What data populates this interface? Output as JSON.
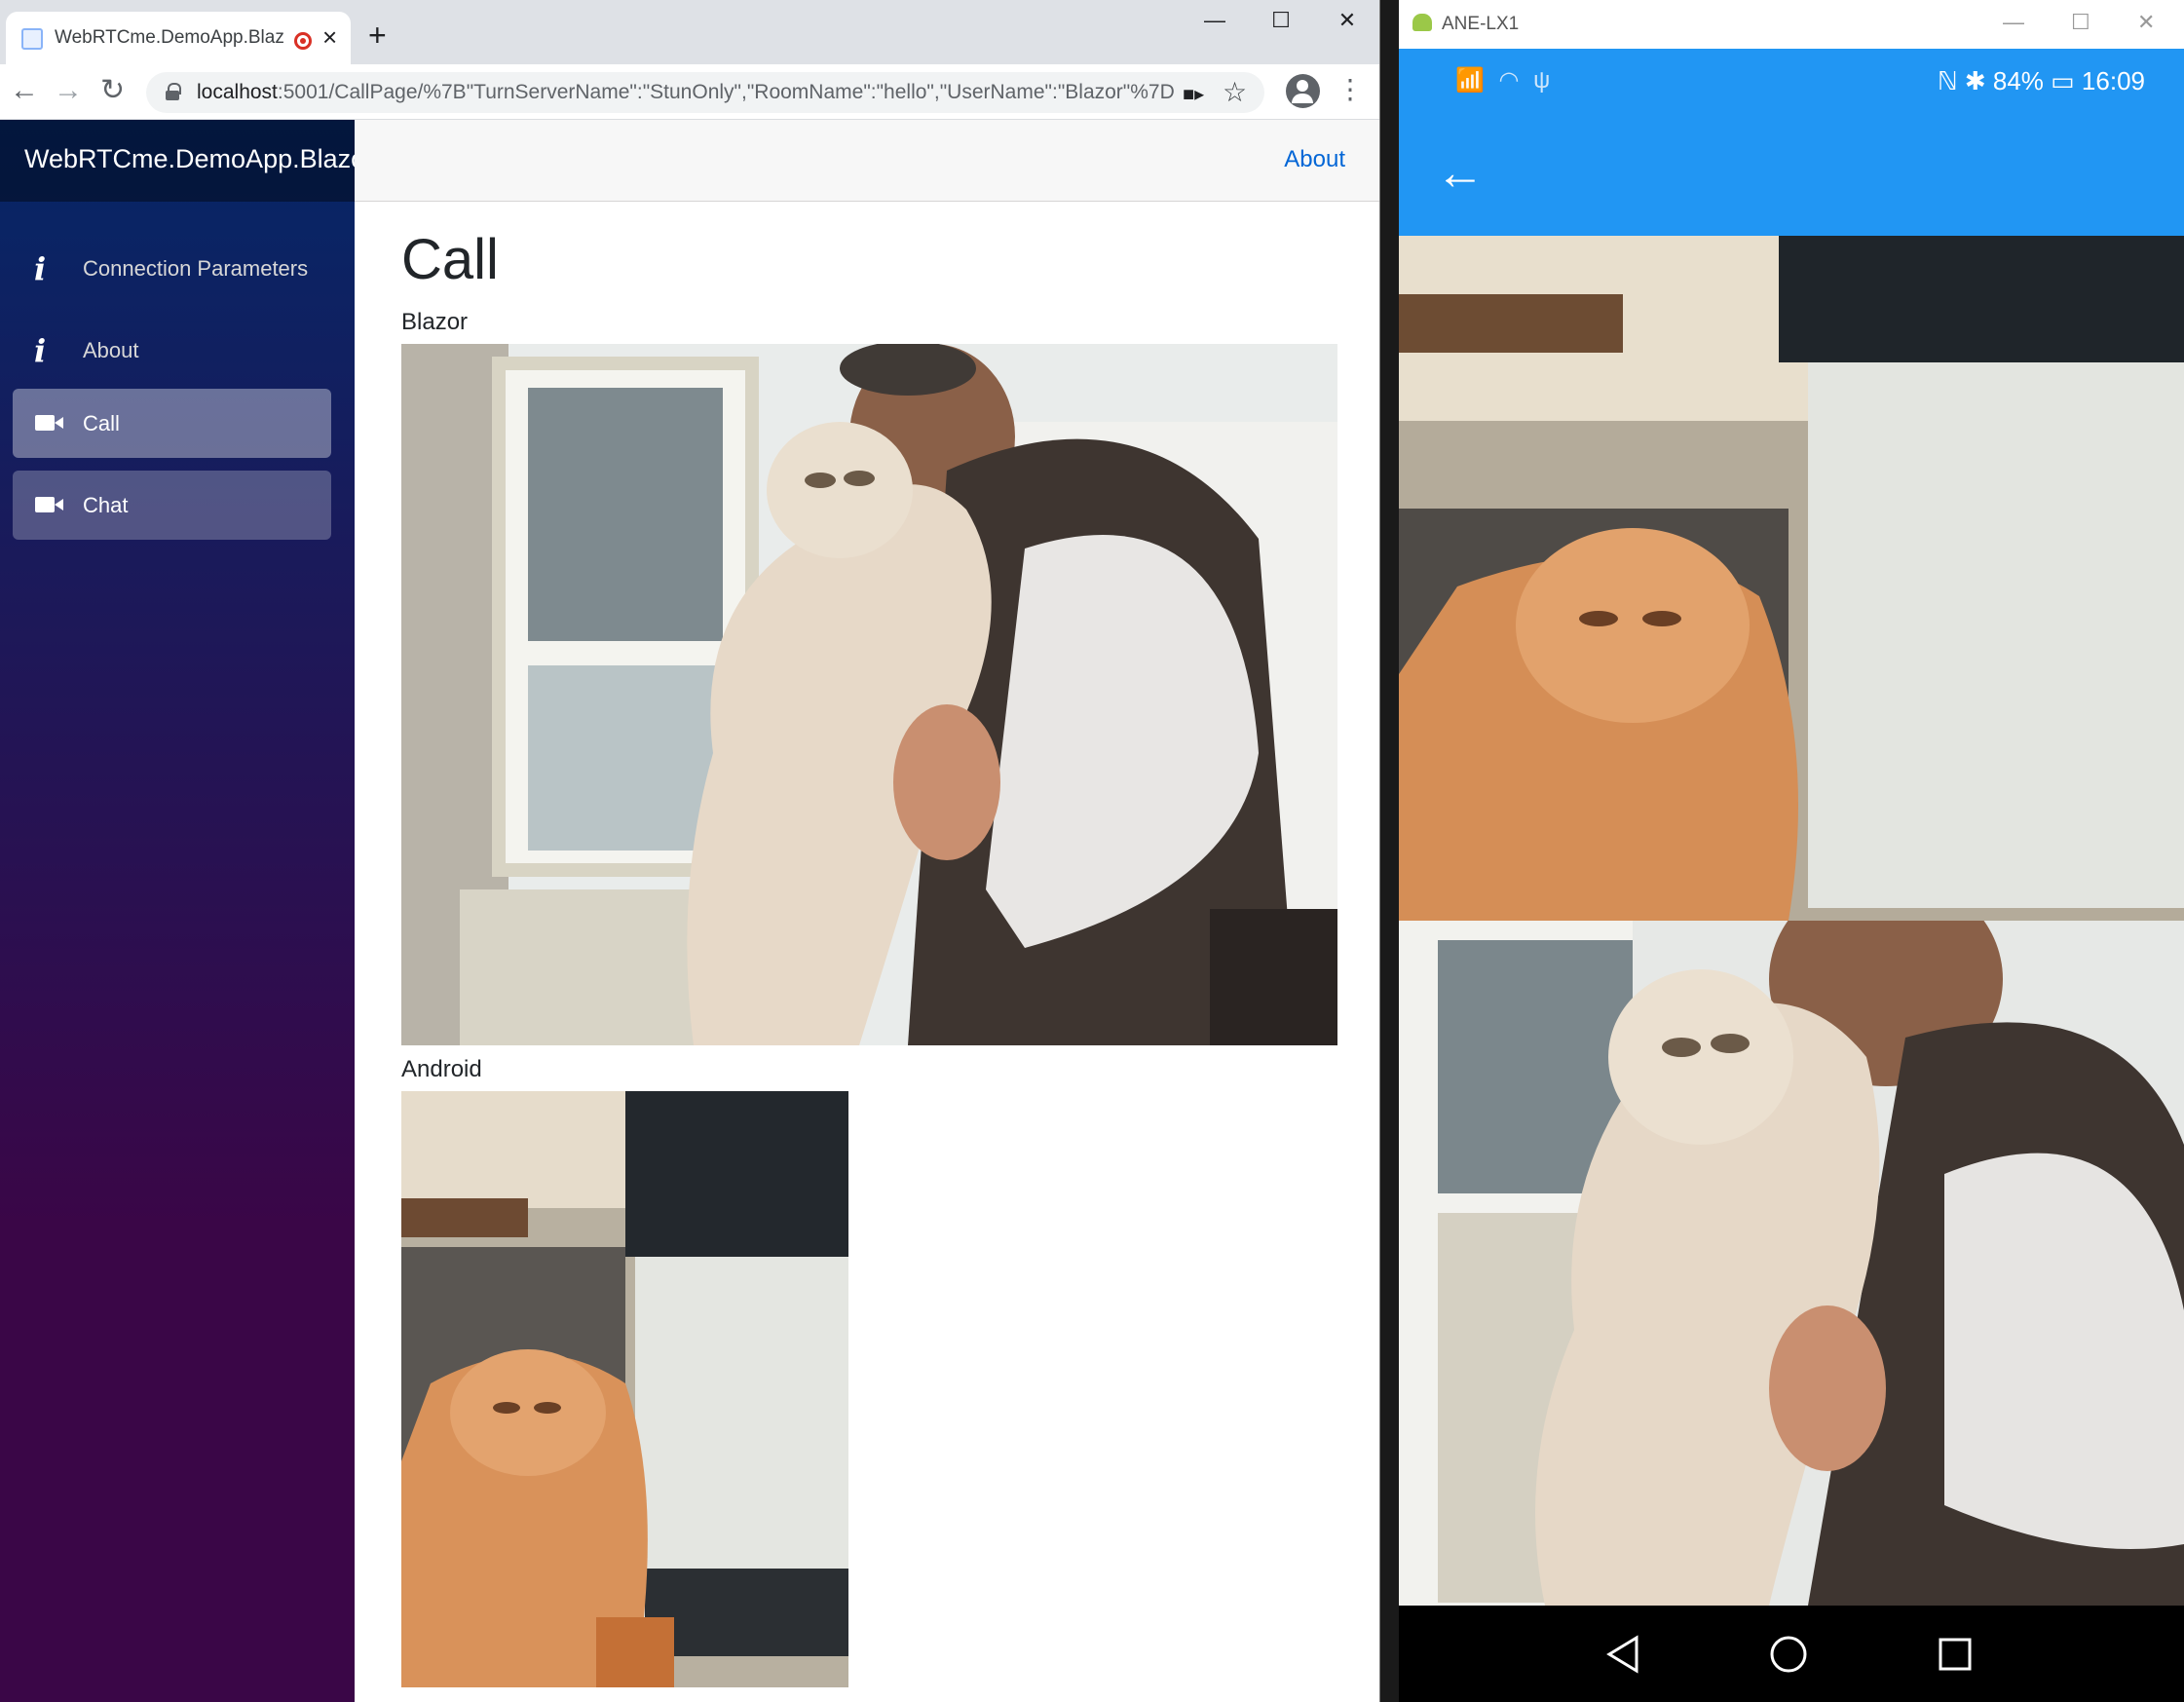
{
  "browser": {
    "tab_title": "WebRTCme.DemoApp.Blazor",
    "tab_close": "×",
    "new_tab": "+",
    "window_controls": {
      "minimize": "—",
      "maximize": "☐",
      "close": "✕"
    },
    "nav": {
      "back": "←",
      "forward": "→",
      "reload": "↻"
    },
    "url_host": "localhost",
    "url_rest": ":5001/CallPage/%7B\"TurnServerName\":\"StunOnly\",\"RoomName\":\"hello\",\"UserName\":\"Blazor\"%7D",
    "camera_indicator": "■▸",
    "star": "☆",
    "menu": "⋮"
  },
  "app": {
    "brand": "WebRTCme.DemoApp.Blazor",
    "sidebar": {
      "items": [
        {
          "label": "Connection Parameters",
          "icon": "info-icon",
          "glyph": "i",
          "state": "normal"
        },
        {
          "label": "About",
          "icon": "info-icon",
          "glyph": "i",
          "state": "normal"
        },
        {
          "label": "Call",
          "icon": "video-camera-icon",
          "state": "active"
        },
        {
          "label": "Chat",
          "icon": "video-camera-icon",
          "state": "highlighted"
        }
      ]
    },
    "topbar": {
      "about": "About"
    },
    "main": {
      "title": "Call",
      "streams": [
        {
          "label": "Blazor",
          "scene": "person-holding-cat"
        },
        {
          "label": "Android",
          "scene": "cat-in-front-of-monitor"
        }
      ]
    }
  },
  "phone": {
    "window_title": "ANE-LX1",
    "window_controls": {
      "minimize": "—",
      "maximize": "☐",
      "close": "✕"
    },
    "status_left": "📶 ◠ ψ",
    "status_right": "ℕ ✱ 84% ▭ 16:09",
    "back_arrow": "←",
    "streams": [
      {
        "scene": "cat-in-front-of-monitor"
      },
      {
        "scene": "person-holding-cat"
      }
    ],
    "nav_icons": [
      "back-triangle-icon",
      "home-circle-icon",
      "recents-square-icon"
    ]
  },
  "colors": {
    "sidebar_top": "#052767",
    "sidebar_bottom": "#3a0647",
    "android_blue": "#2196f3",
    "link": "#0366d6"
  }
}
